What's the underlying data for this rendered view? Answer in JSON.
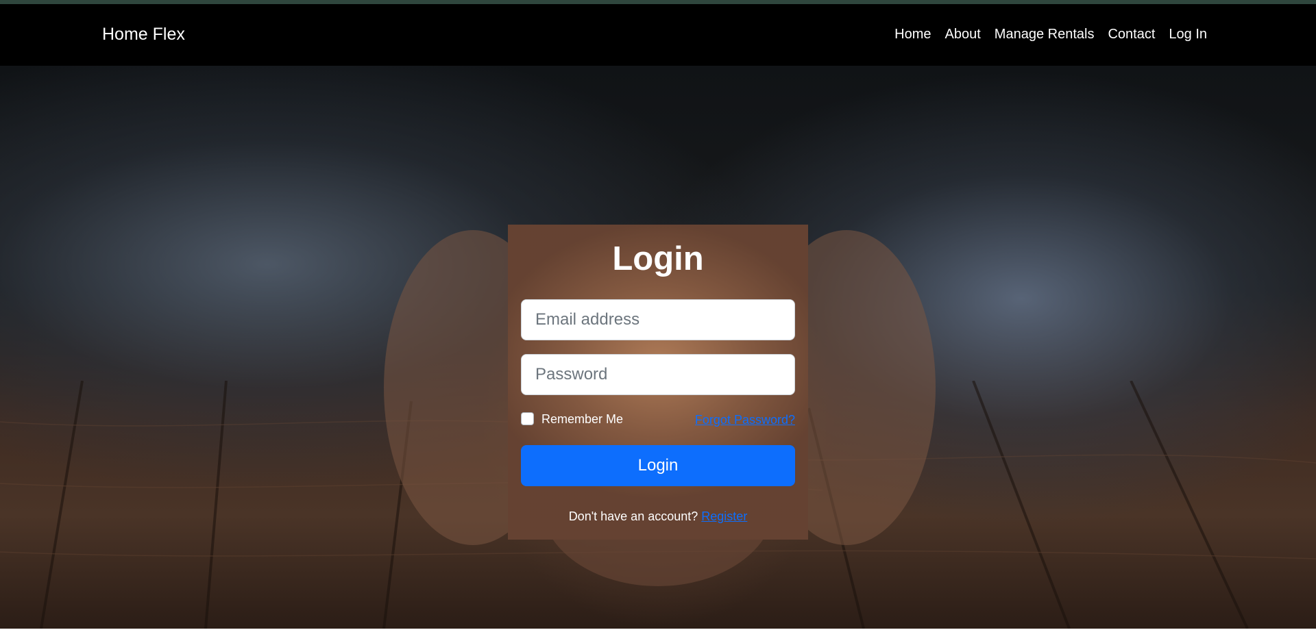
{
  "nav": {
    "brand": "Home Flex",
    "links": [
      "Home",
      "About",
      "Manage Rentals",
      "Contact",
      "Log In"
    ]
  },
  "login": {
    "title": "Login",
    "email_placeholder": "Email address",
    "password_placeholder": "Password",
    "remember_label": "Remember Me",
    "forgot_label": "Forgot Password?",
    "submit_label": "Login",
    "signup_prompt": "Don't have an account?",
    "register_label": "Register"
  },
  "colors": {
    "navbar": "#000000",
    "primary": "#0d6efd",
    "link": "#0d6efd"
  }
}
